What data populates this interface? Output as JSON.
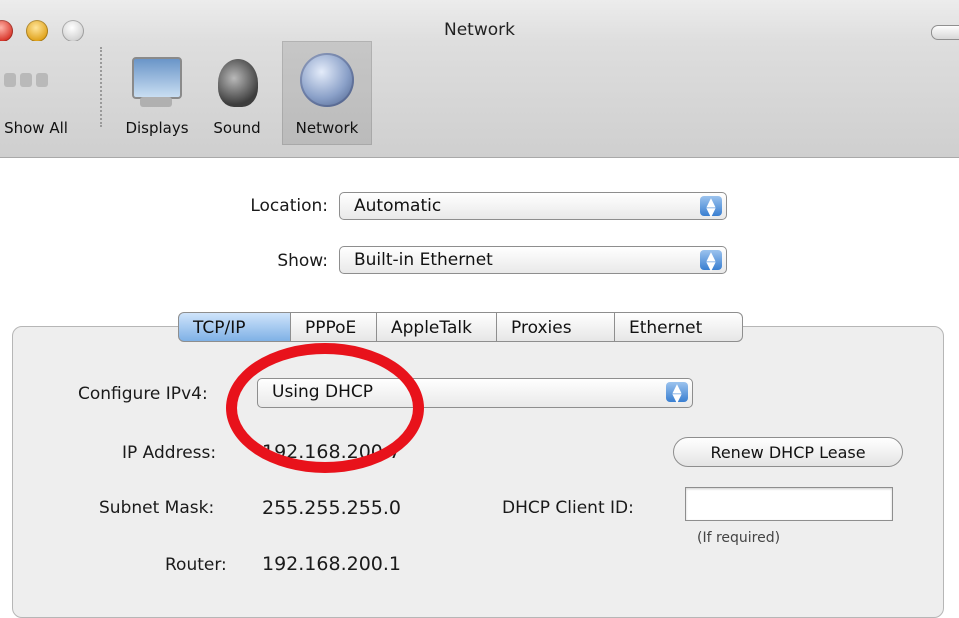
{
  "window": {
    "title": "Network"
  },
  "toolbar": {
    "items": [
      {
        "label": "Show All",
        "icon": "show-all-icon"
      },
      {
        "label": "Displays",
        "icon": "displays-icon"
      },
      {
        "label": "Sound",
        "icon": "sound-icon"
      },
      {
        "label": "Network",
        "icon": "network-icon",
        "selected": true
      }
    ]
  },
  "location": {
    "label": "Location:",
    "value": "Automatic"
  },
  "show": {
    "label": "Show:",
    "value": "Built-in Ethernet"
  },
  "tabs": [
    {
      "label": "TCP/IP",
      "active": true
    },
    {
      "label": "PPPoE"
    },
    {
      "label": "AppleTalk"
    },
    {
      "label": "Proxies"
    },
    {
      "label": "Ethernet"
    }
  ],
  "tcpip": {
    "configure_label": "Configure IPv4:",
    "configure_value": "Using DHCP",
    "ip_label": "IP Address:",
    "ip_value": "192.168.200.7",
    "subnet_label": "Subnet Mask:",
    "subnet_value": "255.255.255.0",
    "router_label": "Router:",
    "router_value": "192.168.200.1",
    "renew_button": "Renew DHCP Lease",
    "client_id_label": "DHCP Client ID:",
    "client_id_value": "",
    "client_id_hint": "(If required)"
  },
  "colors": {
    "annotation": "#e8121b",
    "tab_active": "#7fb1e6"
  }
}
